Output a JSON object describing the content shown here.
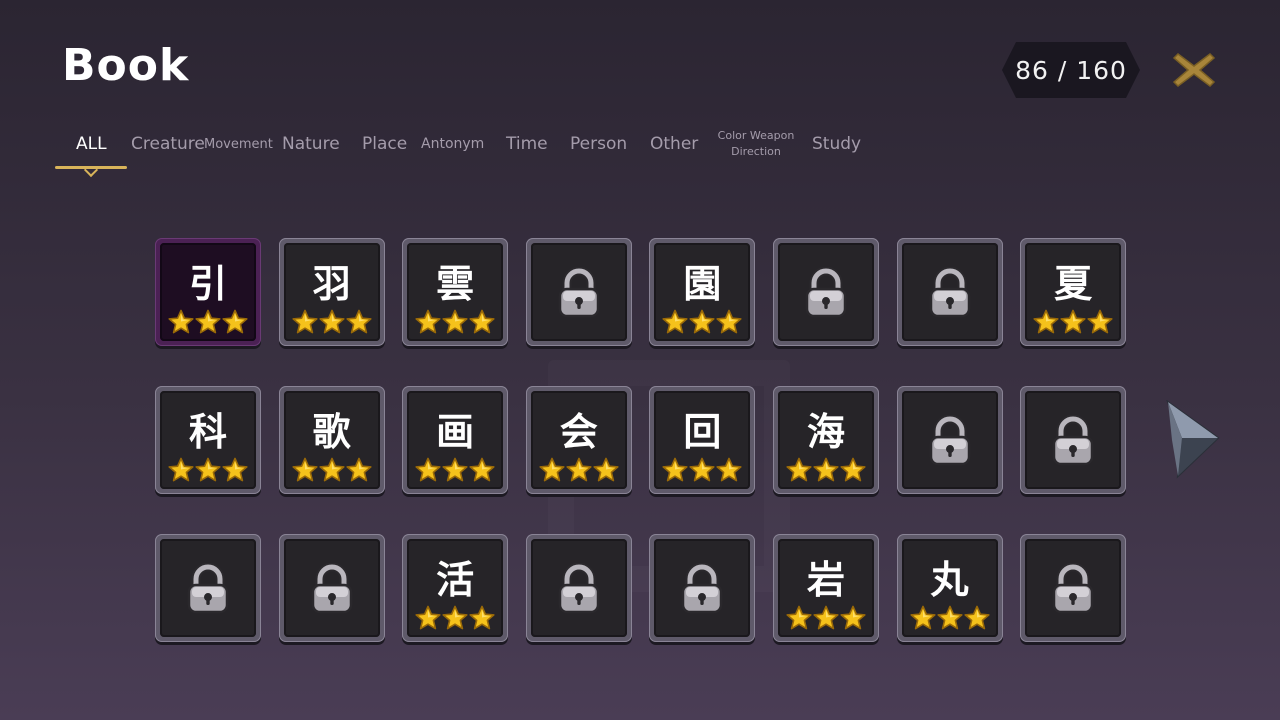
{
  "header": {
    "title": "Book",
    "counter": "86 / 160",
    "close_icon": "close-x-icon",
    "accent_color": "#d9b45a"
  },
  "tabs": [
    {
      "label": "ALL",
      "active": true
    },
    {
      "label": "Creature"
    },
    {
      "label": "Movement"
    },
    {
      "label": "Nature"
    },
    {
      "label": "Place"
    },
    {
      "label": "Antonym"
    },
    {
      "label": "Time"
    },
    {
      "label": "Person"
    },
    {
      "label": "Other"
    },
    {
      "label_line1": "Color Weapon",
      "label_line2": "Direction"
    },
    {
      "label": "Study"
    }
  ],
  "cards": [
    {
      "kanji": "引",
      "stars": 3,
      "selected": true
    },
    {
      "kanji": "羽",
      "stars": 3
    },
    {
      "kanji": "雲",
      "stars": 3
    },
    {
      "locked": true
    },
    {
      "kanji": "園",
      "stars": 3
    },
    {
      "locked": true
    },
    {
      "locked": true
    },
    {
      "kanji": "夏",
      "stars": 3
    },
    {
      "kanji": "科",
      "stars": 3
    },
    {
      "kanji": "歌",
      "stars": 3
    },
    {
      "kanji": "画",
      "stars": 3
    },
    {
      "kanji": "会",
      "stars": 3
    },
    {
      "kanji": "回",
      "stars": 3
    },
    {
      "kanji": "海",
      "stars": 3
    },
    {
      "locked": true
    },
    {
      "locked": true
    },
    {
      "locked": true
    },
    {
      "locked": true
    },
    {
      "kanji": "活",
      "stars": 3
    },
    {
      "locked": true
    },
    {
      "locked": true
    },
    {
      "kanji": "岩",
      "stars": 3
    },
    {
      "kanji": "丸",
      "stars": 3
    },
    {
      "locked": true
    }
  ],
  "icons": {
    "star": "star-icon",
    "lock": "padlock-icon",
    "next": "next-page-arrow-icon"
  }
}
